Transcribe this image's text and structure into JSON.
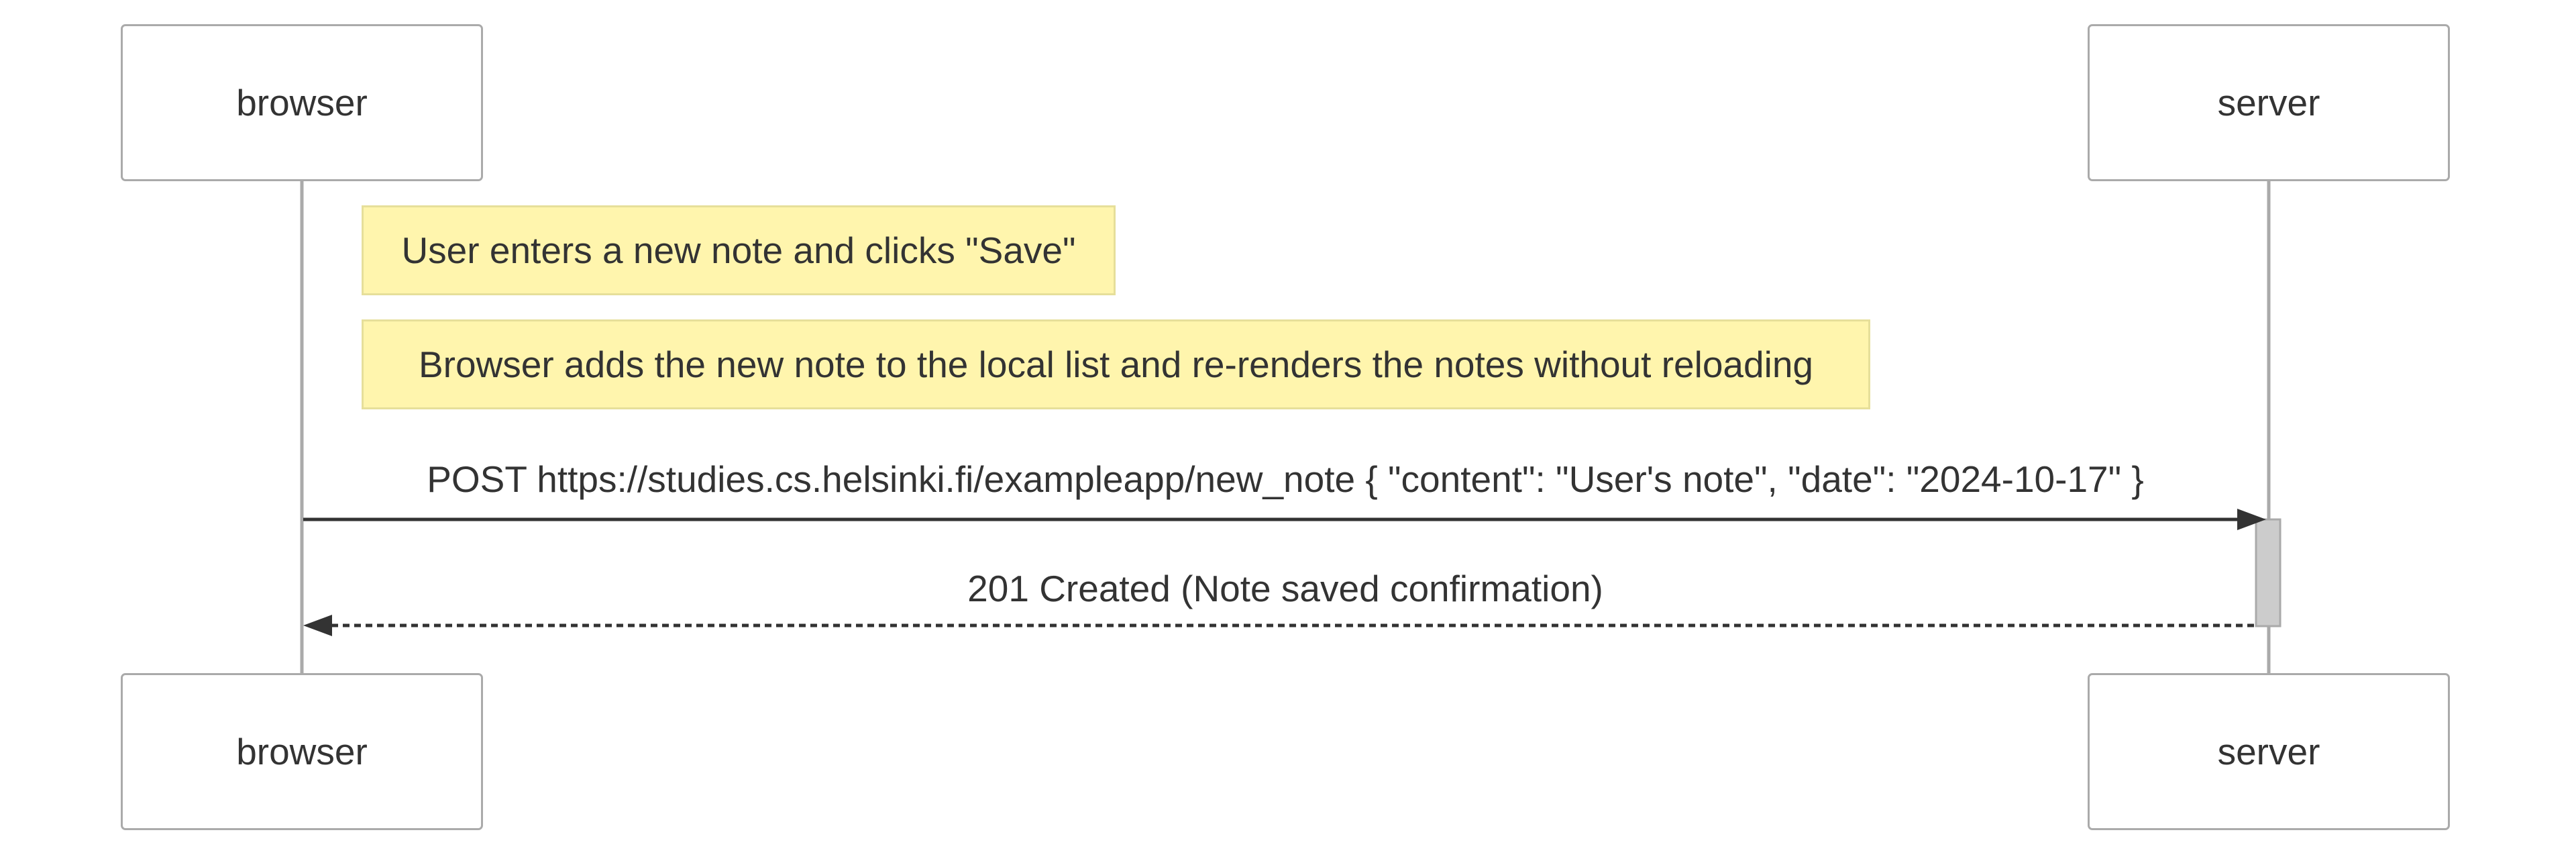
{
  "participants": {
    "browser": "browser",
    "server": "server"
  },
  "notes": [
    {
      "text": "User enters a new note and clicks \"Save\""
    },
    {
      "text": "Browser adds the new note to the local list and re-renders the notes without reloading"
    }
  ],
  "messages": [
    {
      "from": "browser",
      "to": "server",
      "text": "POST https://studies.cs.helsinki.fi/exampleapp/new_note { \"content\": \"User's note\", \"date\": \"2024-10-17\" }",
      "style": "solid"
    },
    {
      "from": "server",
      "to": "browser",
      "text": "201 Created (Note saved confirmation)",
      "style": "dashed"
    }
  ],
  "colors": {
    "note_fill": "#fff5ad",
    "note_border": "#e6df9a",
    "actor_border": "#aaaaaa",
    "lifeline": "#aaaaaa",
    "arrow": "#333333",
    "activation": "#cccccc"
  }
}
